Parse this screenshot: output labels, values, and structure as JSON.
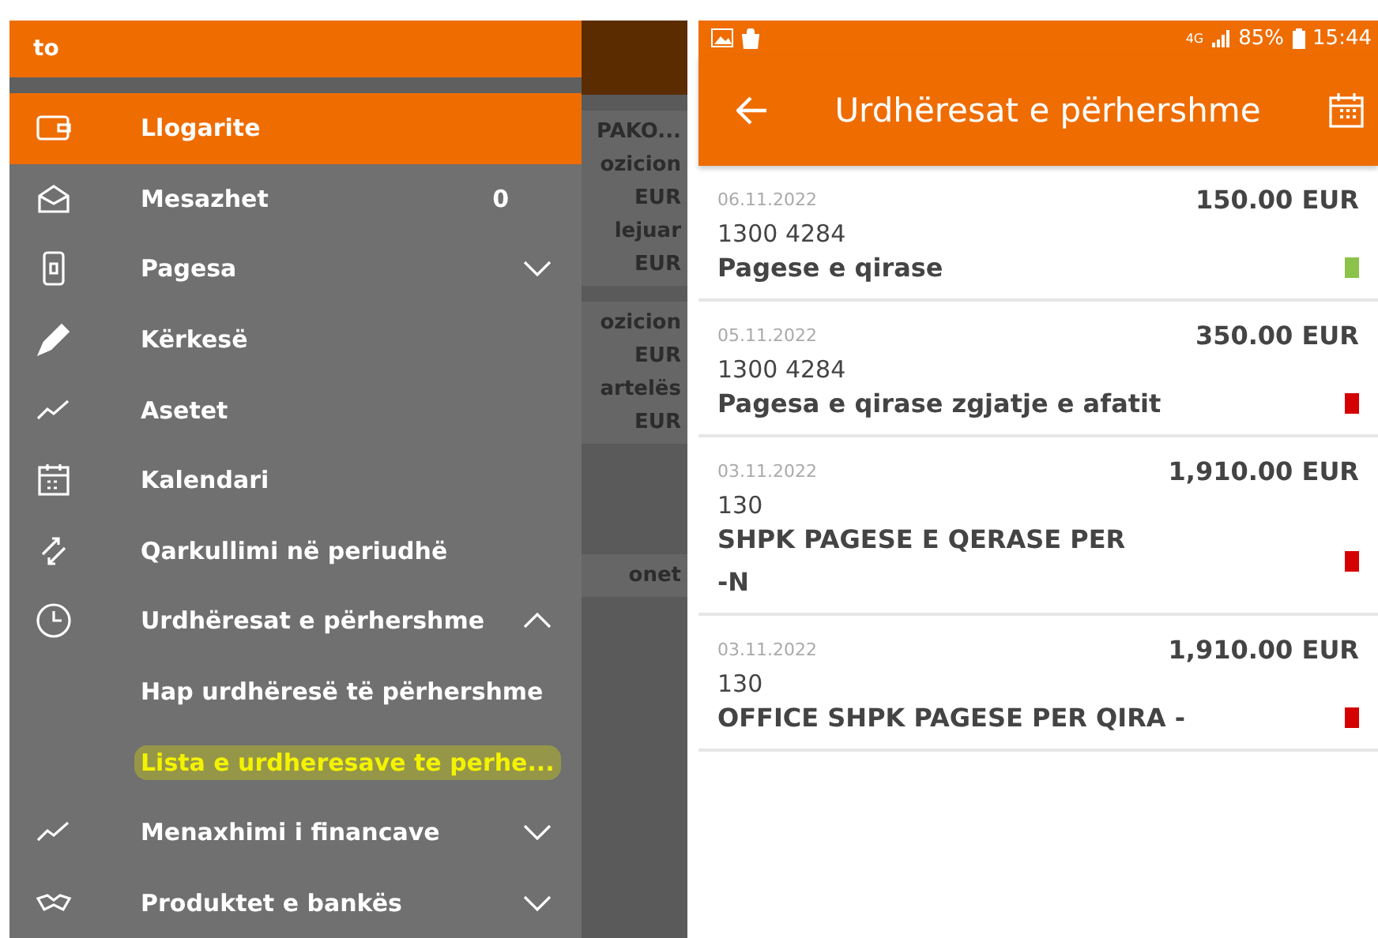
{
  "drawer": {
    "username": "to",
    "items": [
      {
        "kind": "link",
        "label": "Llogarite",
        "selected": true
      },
      {
        "kind": "link",
        "label": "Mesazhet",
        "selected": false,
        "badge": "0"
      },
      {
        "kind": "group",
        "label": "Pagesa",
        "selected": false,
        "expanded": false
      },
      {
        "kind": "link",
        "label": "Kërkesë",
        "selected": false
      },
      {
        "kind": "link",
        "label": "Asetet",
        "selected": false
      },
      {
        "kind": "link",
        "label": "Kalendari",
        "selected": false
      },
      {
        "kind": "link",
        "label": "Qarkullimi në periudhë",
        "selected": false
      },
      {
        "kind": "group",
        "label": "Urdhëresat e përhershme",
        "selected": false,
        "expanded": true,
        "children": [
          {
            "label": "Hap urdhëresë të përhershme",
            "highlighted": false
          },
          {
            "label": "Lista e urdheresave te perhe...",
            "highlighted": true
          }
        ]
      },
      {
        "kind": "group",
        "label": "Menaxhimi i financave",
        "selected": false,
        "expanded": false
      },
      {
        "kind": "group",
        "label": "Produktet e bankës",
        "selected": false,
        "expanded": false
      }
    ]
  },
  "background_strip": [
    "PAKO...",
    "ozicion",
    "EUR",
    "lejuar",
    "EUR",
    "ozicion",
    "EUR",
    "artelës",
    "EUR",
    "onet"
  ],
  "status_bar": {
    "network": "4G",
    "battery": "85%",
    "time": "15:44"
  },
  "toolbar": {
    "title": "Urdhëresat e përhershme"
  },
  "orders": [
    {
      "date": "06.11.2022",
      "amount": "150.00 EUR",
      "account": "1300 4284",
      "description": [
        "Pagese e qirase"
      ],
      "color": "#8bc34a"
    },
    {
      "date": "05.11.2022",
      "amount": "350.00 EUR",
      "account": "1300 4284",
      "description": [
        "Pagesa e qirase zgjatje e afatit"
      ],
      "color": "#d50000"
    },
    {
      "date": "03.11.2022",
      "amount": "1,910.00 EUR",
      "account": "130",
      "description": [
        "SHPK PAGESE E QERASE PER",
        "-N"
      ],
      "color": "#d50000"
    },
    {
      "date": "03.11.2022",
      "amount": "1,910.00 EUR",
      "account": "130",
      "description": [
        "OFFICE SHPK PAGESE PER QIRA -"
      ],
      "color": "#d50000"
    }
  ]
}
